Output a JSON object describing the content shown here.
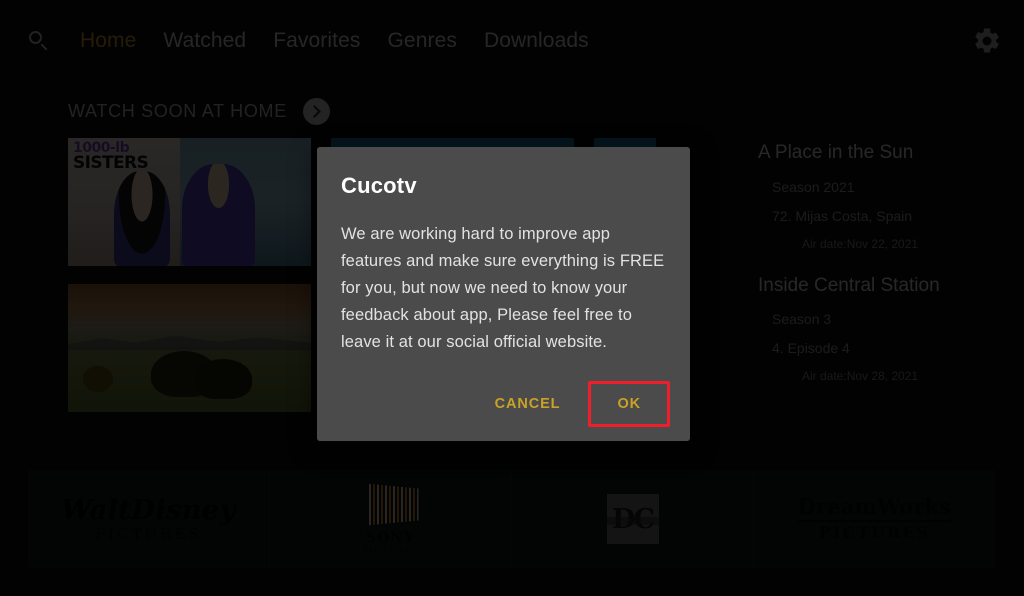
{
  "topbar": {
    "search_icon": "search-icon",
    "settings_icon": "gear-icon",
    "nav": [
      {
        "label": "Home",
        "active": true
      },
      {
        "label": "Watched",
        "active": false
      },
      {
        "label": "Favorites",
        "active": false
      },
      {
        "label": "Genres",
        "active": false
      },
      {
        "label": "Downloads",
        "active": false
      }
    ]
  },
  "section": {
    "title": "WATCH SOON AT HOME",
    "more_icon": "chevron-right-icon"
  },
  "details": [
    {
      "title": "A Place in the Sun",
      "season": "Season 2021",
      "episode": "72. Mijas Costa, Spain",
      "airdate": "Air date:Nov 22, 2021"
    },
    {
      "title": "Inside Central Station",
      "season": "Season 3",
      "episode": "4. Episode 4",
      "airdate": "Air date:Nov 28, 2021"
    }
  ],
  "studios": [
    {
      "name": "Walt Disney Pictures",
      "line1": "WaltDisney",
      "line2": "PICTURES"
    },
    {
      "name": "Sony Pictures",
      "line1": "SONY",
      "line2": "PICTURES"
    },
    {
      "name": "DC",
      "line1": "DC",
      "line2": ""
    },
    {
      "name": "DreamWorks Pictures",
      "line1": "DreamWorks",
      "line2": "PICTURES"
    }
  ],
  "poster_labels": {
    "sisters_line1": "1000-lb",
    "sisters_line2": "SISTERS"
  },
  "dialog": {
    "title": "Cucotv",
    "message": "We are working hard to improve app features and make sure everything is FREE for you, but now we need to know your feedback about app, Please feel free to leave it at our social official website.",
    "cancel_label": "CANCEL",
    "ok_label": "OK"
  },
  "colors": {
    "accent_gold": "#c9a227",
    "highlight_red": "#ee1f2b",
    "dialog_bg": "#4b4b4b",
    "page_bg": "#050505"
  }
}
